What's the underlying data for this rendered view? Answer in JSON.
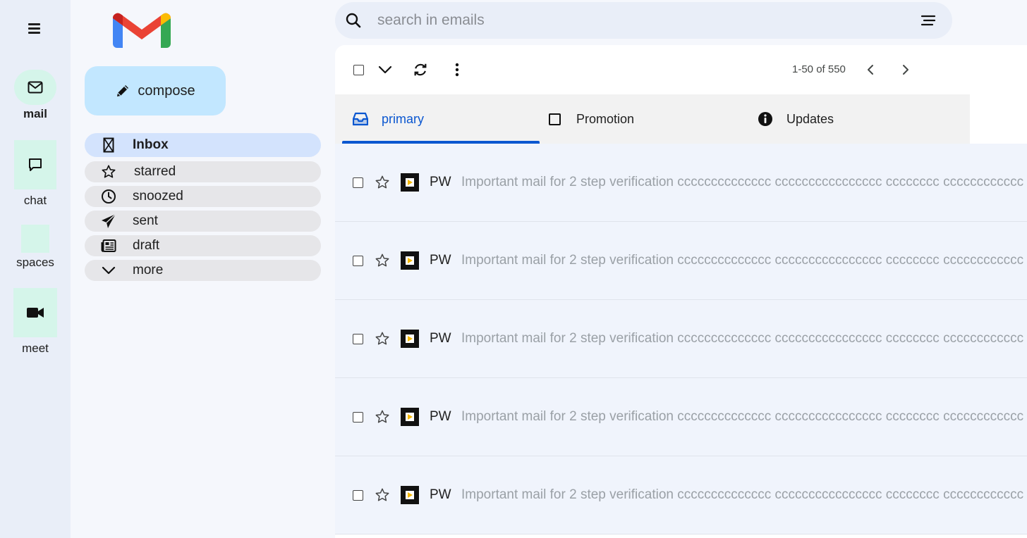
{
  "rail": {
    "items": [
      {
        "label": "mail",
        "icon": "mail-icon"
      },
      {
        "label": "chat",
        "icon": "chat-icon"
      },
      {
        "label": "spaces",
        "icon": "spaces-icon"
      },
      {
        "label": "meet",
        "icon": "video-icon"
      }
    ]
  },
  "sidebar": {
    "compose_label": "compose",
    "items": [
      {
        "label": "Inbox",
        "icon": "inbox-icon",
        "active": true
      },
      {
        "label": "starred",
        "icon": "star-icon"
      },
      {
        "label": "snoozed",
        "icon": "clock-icon"
      },
      {
        "label": "sent",
        "icon": "send-icon"
      },
      {
        "label": "draft",
        "icon": "draft-icon"
      },
      {
        "label": "more",
        "icon": "chevron-down-icon"
      }
    ]
  },
  "search": {
    "placeholder": "search in emails"
  },
  "toolbar": {
    "pagination": "1-50 of 550"
  },
  "tabs": [
    {
      "label": "primary",
      "icon": "inbox-tray-icon",
      "active": true
    },
    {
      "label": "Promotion",
      "icon": "square-icon"
    },
    {
      "label": "Updates",
      "icon": "info-icon"
    }
  ],
  "emails": [
    {
      "sender": "PW",
      "subject": "Important mail for 2 step verification cccccccccccccc cccccccccccccccc cccccccc cccccccccccc"
    },
    {
      "sender": "PW",
      "subject": "Important mail for 2 step verification cccccccccccccc cccccccccccccccc cccccccc cccccccccccc"
    },
    {
      "sender": "PW",
      "subject": "Important mail for 2 step verification cccccccccccccc cccccccccccccccc cccccccc cccccccccccc"
    },
    {
      "sender": "PW",
      "subject": "Important mail for 2 step verification cccccccccccccc cccccccccccccccc cccccccc cccccccccccc"
    },
    {
      "sender": "PW",
      "subject": "Important mail for 2 step verification cccccccccccccc cccccccccccccccc cccccccc cccccccccccc"
    }
  ],
  "colors": {
    "accent": "#0b57d0",
    "compose_bg": "#c2e7ff",
    "rail_highlight": "#d5f5ea",
    "active_nav": "#d3e3fd"
  }
}
